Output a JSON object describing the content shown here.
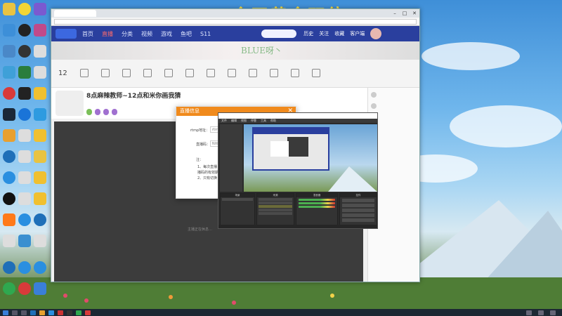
{
  "desktop": {
    "banner_text": "今天黄金双倍",
    "icons": [
      "app-icon",
      "app-icon",
      "app-icon",
      "app-icon",
      "app-icon",
      "app-icon",
      "app-icon",
      "app-icon",
      "app-icon",
      "app-icon",
      "app-icon",
      "app-icon"
    ]
  },
  "browser": {
    "tab_title": "",
    "address": "",
    "site_nav": {
      "links": [
        "首页",
        "直播",
        "分类",
        "视频",
        "游戏",
        "鱼吧",
        "S11"
      ],
      "active_index": 1,
      "icons": [
        "历史",
        "关注",
        "收藏",
        "客户端"
      ]
    },
    "hero_text": "BLUE呀丶",
    "toolbar": {
      "count": "12"
    },
    "room": {
      "title": "8点麻辣教师~12点和米你画我猜",
      "meta": "",
      "tags": [
        "",
        "",
        "",
        ""
      ]
    },
    "stage_caption": "主播正在休息…"
  },
  "chat": {
    "rows": [
      {
        "name": "",
        "badge": ""
      },
      {
        "name": "",
        "badge": ""
      },
      {
        "name": "",
        "badge": ""
      },
      {
        "name": "",
        "badge": ""
      },
      {
        "name": "",
        "badge": ""
      },
      {
        "name": "",
        "badge": ""
      },
      {
        "name": "",
        "badge": ""
      },
      {
        "name": "",
        "badge": ""
      },
      {
        "name": "",
        "badge": ""
      },
      {
        "name": "",
        "badge": ""
      }
    ]
  },
  "dialog": {
    "title": "直播信息",
    "close_glyph": "✕",
    "rtmp_label": "rtmp地址：",
    "rtmp_value": "rtmp",
    "code_label": "直播码：",
    "code_value": "NXf",
    "note_label": "注：",
    "note_line1": "1、每次直播",
    "note_line2": "播码的有效期",
    "note_line3": "2、只有切换"
  },
  "obs": {
    "title": "",
    "menu": [
      "文件",
      "编辑",
      "视图",
      "停靠",
      "工具",
      "帮助"
    ],
    "docks": [
      "场景",
      "来源",
      "混音器",
      "转场",
      "控件"
    ],
    "sources": [
      "",
      "",
      "",
      "",
      ""
    ],
    "controls": [
      "",
      "",
      "",
      "",
      ""
    ]
  },
  "colors": {
    "site_nav": "#2a3f9e",
    "dialog_header": "#f08a1c",
    "banner": "#f5e04a"
  }
}
